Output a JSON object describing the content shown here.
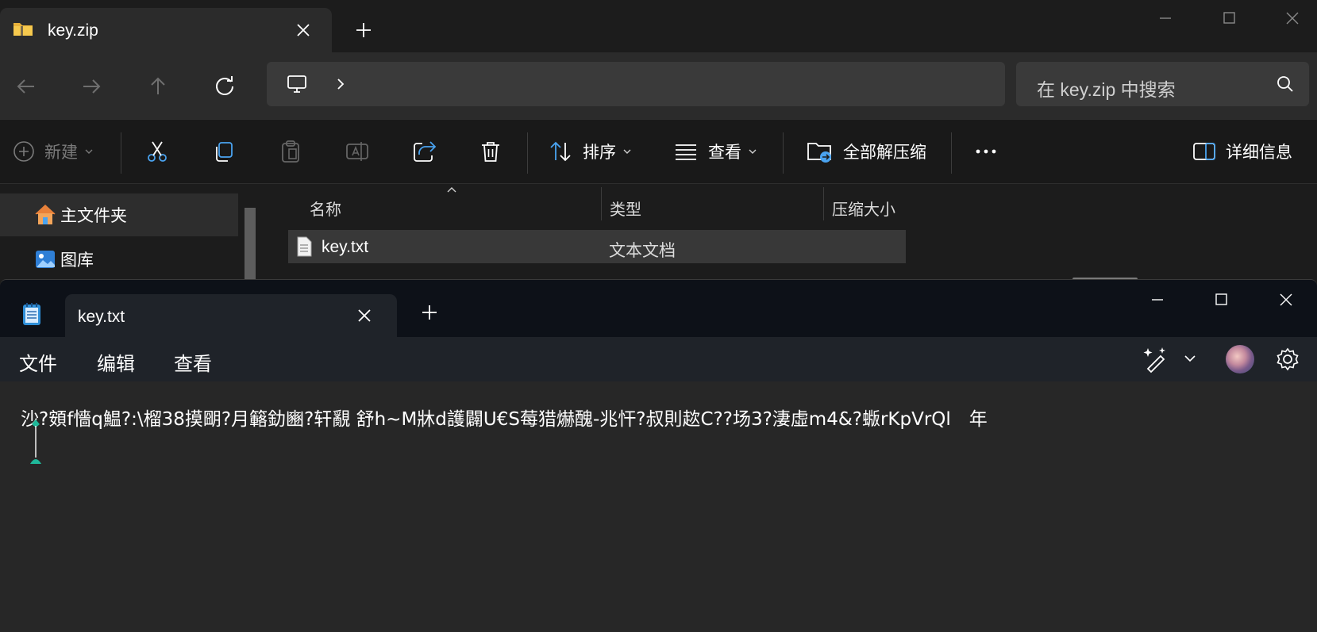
{
  "explorer": {
    "tab_title": "key.zip",
    "search_placeholder": "在 key.zip 中搜索",
    "toolbar": {
      "new_label": "新建",
      "sort_label": "排序",
      "view_label": "查看",
      "extract_all_label": "全部解压缩",
      "details_label": "详细信息"
    },
    "sidebar": {
      "items": [
        {
          "label": "主文件夹",
          "icon": "home-icon"
        },
        {
          "label": "图库",
          "icon": "gallery-icon"
        }
      ]
    },
    "columns": [
      "名称",
      "类型",
      "压缩大小"
    ],
    "files": [
      {
        "name": "key.txt",
        "type": "文本文档",
        "compressed_size": ""
      }
    ]
  },
  "notepad": {
    "tab_title": "key.txt",
    "menu": [
      "文件",
      "编辑",
      "查看"
    ],
    "content": "沙?頞f懎q鰛?:\\榴38摸朙?月簵釛豳?轩覶 舒h~M牀d護闢U€S莓猎爀醜-兆忓?叔則趑C??场3?淒虛m4&?蝂rKpVrQl　年"
  },
  "colors": {
    "explorer_bg": "#1c1c1c",
    "notepad_titlebar": "#0d1118",
    "notepad_menubar": "#1f2329",
    "editor_bg": "#272727",
    "accent_teal": "#1fb89a",
    "accent_blue": "#4aa3f0"
  }
}
